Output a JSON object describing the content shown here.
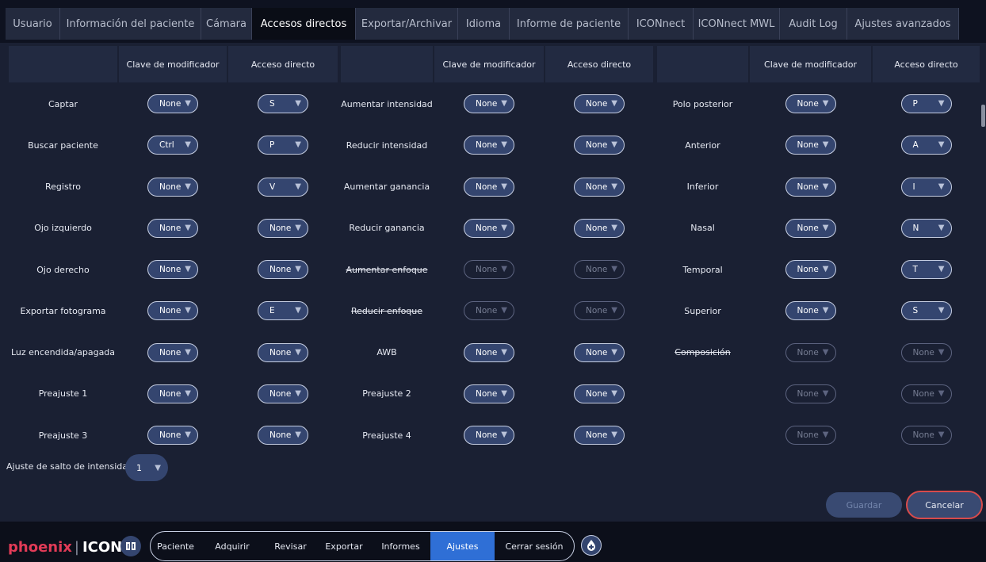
{
  "tabs": [
    {
      "label": "Usuario",
      "active": false
    },
    {
      "label": "Información del paciente",
      "active": false
    },
    {
      "label": "Cámara",
      "active": false
    },
    {
      "label": "Accesos directos",
      "active": true
    },
    {
      "label": "Exportar/Archivar",
      "active": false
    },
    {
      "label": "Idioma",
      "active": false
    },
    {
      "label": "Informe de paciente",
      "active": false
    },
    {
      "label": "ICONnect",
      "active": false
    },
    {
      "label": "ICONnect MWL",
      "active": false
    },
    {
      "label": "Audit Log",
      "active": false
    },
    {
      "label": "Ajustes avanzados",
      "active": false
    }
  ],
  "headers": {
    "modifier": "Clave de modificador",
    "shortcut": "Acceso directo"
  },
  "groups": [
    {
      "rows": [
        {
          "label": "Captar",
          "modifier": "None",
          "shortcut": "S"
        },
        {
          "label": "Buscar paciente",
          "modifier": "Ctrl",
          "shortcut": "P"
        },
        {
          "label": "Registro",
          "modifier": "None",
          "shortcut": "V"
        },
        {
          "label": "Ojo izquierdo",
          "modifier": "None",
          "shortcut": "None"
        },
        {
          "label": "Ojo derecho",
          "modifier": "None",
          "shortcut": "None"
        },
        {
          "label": "Exportar fotograma",
          "modifier": "None",
          "shortcut": "E"
        },
        {
          "label": "Luz encendida/apagada",
          "modifier": "None",
          "shortcut": "None"
        },
        {
          "label": "Preajuste 1",
          "modifier": "None",
          "shortcut": "None"
        },
        {
          "label": "Preajuste 3",
          "modifier": "None",
          "shortcut": "None"
        }
      ]
    },
    {
      "rows": [
        {
          "label": "Aumentar intensidad",
          "modifier": "None",
          "shortcut": "None"
        },
        {
          "label": "Reducir intensidad",
          "modifier": "None",
          "shortcut": "None"
        },
        {
          "label": "Aumentar ganancia",
          "modifier": "None",
          "shortcut": "None"
        },
        {
          "label": "Reducir ganancia",
          "modifier": "None",
          "shortcut": "None"
        },
        {
          "label": "Aumentar enfoque",
          "modifier": "None",
          "shortcut": "None",
          "disabled": true
        },
        {
          "label": "Reducir enfoque",
          "modifier": "None",
          "shortcut": "None",
          "disabled": true
        },
        {
          "label": "AWB",
          "modifier": "None",
          "shortcut": "None"
        },
        {
          "label": "Preajuste 2",
          "modifier": "None",
          "shortcut": "None"
        },
        {
          "label": "Preajuste 4",
          "modifier": "None",
          "shortcut": "None"
        }
      ]
    },
    {
      "rows": [
        {
          "label": "Polo posterior",
          "modifier": "None",
          "shortcut": "P"
        },
        {
          "label": "Anterior",
          "modifier": "None",
          "shortcut": "A"
        },
        {
          "label": "Inferior",
          "modifier": "None",
          "shortcut": "I"
        },
        {
          "label": "Nasal",
          "modifier": "None",
          "shortcut": "N"
        },
        {
          "label": "Temporal",
          "modifier": "None",
          "shortcut": "T"
        },
        {
          "label": "Superior",
          "modifier": "None",
          "shortcut": "S"
        },
        {
          "label": "Composición",
          "modifier": "None",
          "shortcut": "None",
          "disabled": true
        },
        {
          "label": "",
          "modifier": "None",
          "shortcut": "None",
          "disabled": true
        },
        {
          "label": "",
          "modifier": "None",
          "shortcut": "None",
          "disabled": true
        }
      ]
    }
  ],
  "intensity_step": {
    "label": "Ajuste de salto de intensidad:",
    "value": "1"
  },
  "buttons": {
    "save": "Guardar",
    "cancel": "Cancelar"
  },
  "footer": {
    "logo_brand": "phoenix",
    "logo_product": "ICON",
    "nav": [
      "Paciente",
      "Adquirir",
      "Revisar",
      "Exportar",
      "Informes",
      "Ajustes",
      "Cerrar sesión"
    ],
    "active_nav": "Ajustes"
  },
  "colors": {
    "accent": "#2f6fd6",
    "pill": "#34456f",
    "cancel_border": "#d94b4b",
    "brand": "#e23b57"
  }
}
